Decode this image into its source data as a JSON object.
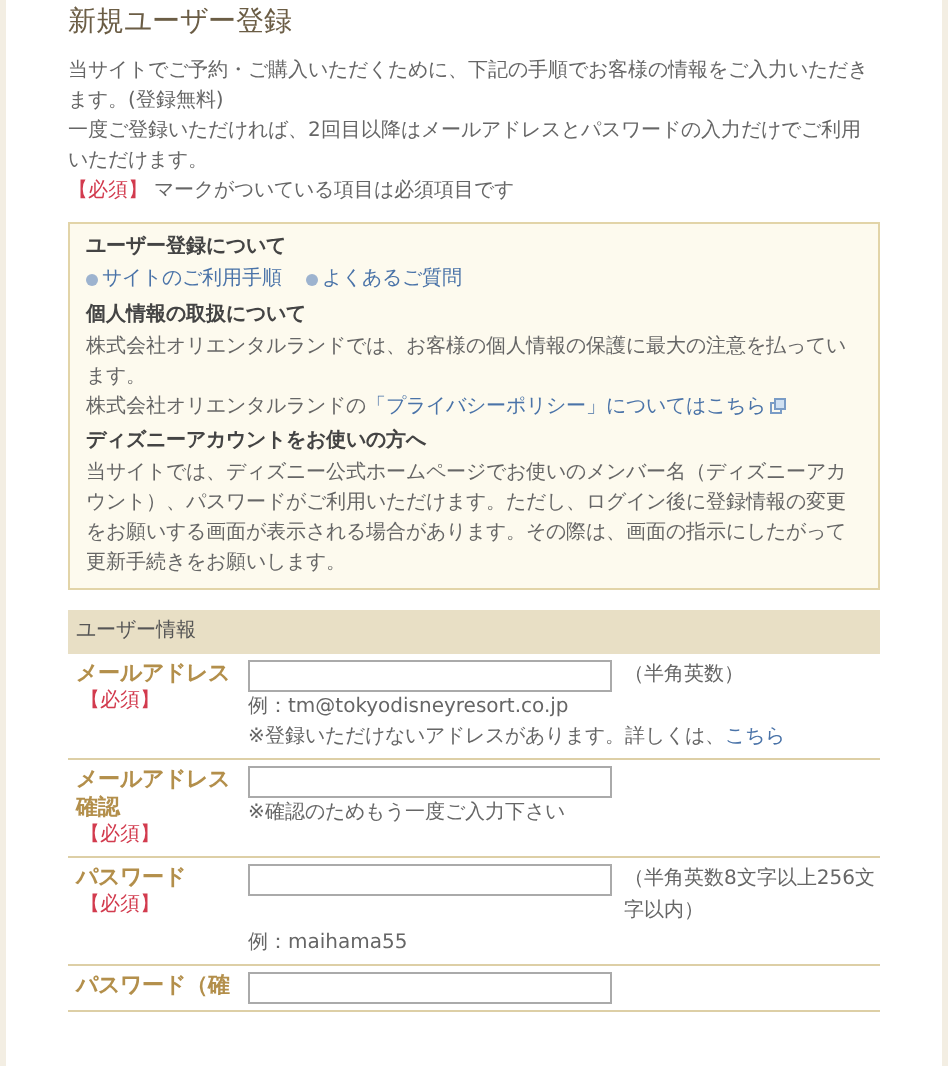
{
  "title": "新規ユーザー登録",
  "intro": [
    "当サイトでご予約・ご購入いただくために、下記の手順でお客様の情報をご入力いただきます。(登録無料)",
    "一度ご登録いただければ、2回目以降はメールアドレスとパスワードの入力だけでご利用いただけます。"
  ],
  "required_note": {
    "mark": "【必須】",
    "text": "マークがついている項目は必須項目です"
  },
  "info_box": [
    {
      "kind": "links",
      "heading": "ユーザー登録について",
      "links": [
        "サイトのご利用手順",
        "よくあるご質問"
      ]
    },
    {
      "kind": "text",
      "heading": "個人情報の取扱について",
      "paragraphs": [
        {
          "text": "株式会社オリエンタルランドでは、お客様の個人情報の保護に最大の注意を払っています。"
        },
        {
          "text": "株式会社オリエンタルランドの",
          "link": "「プライバシーポリシー」についてはこちら"
        }
      ]
    },
    {
      "kind": "text",
      "heading": "ディズニーアカウントをお使いの方へ",
      "paragraphs": [
        {
          "text": "当サイトでは、ディズニー公式ホームページでお使いのメンバー名（ディズニーアカウント）、パスワードがご利用いただけます。ただし、ログイン後に登録情報の変更をお願いする画面が表示される場合があります。その際は、画面の指示にしたがって更新手続きをお願いします。"
        }
      ]
    }
  ],
  "form": {
    "header": "ユーザー情報",
    "rows": [
      {
        "label": "メールアドレス",
        "required": "【必須】",
        "hint": "（半角英数）",
        "notes": [
          {
            "text": "例：tm@tokyodisneyresort.co.jp"
          },
          {
            "text": "※登録いただけないアドレスがあります。詳しくは、",
            "link": "こちら"
          }
        ]
      },
      {
        "label": "メールアドレス確認",
        "required": "【必須】",
        "notes": [
          {
            "text": "※確認のためもう一度ご入力下さい"
          }
        ]
      },
      {
        "label": "パスワード",
        "required": "【必須】",
        "hint": "（半角英数8文字以上256文字以内）",
        "notes": [
          {
            "text": "例：maihama55"
          }
        ]
      },
      {
        "label": "パスワード（確"
      }
    ]
  }
}
